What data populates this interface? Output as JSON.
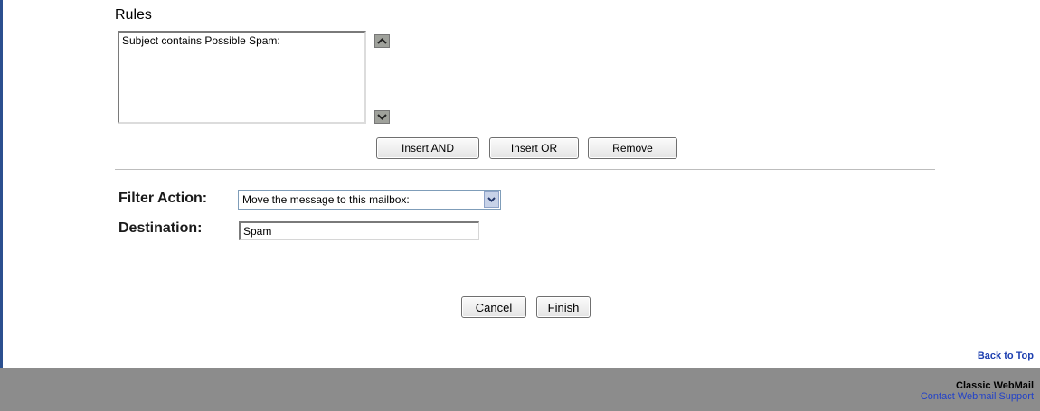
{
  "rules": {
    "heading": "Rules",
    "items": [
      "Subject contains Possible Spam:"
    ],
    "move_up_icon": "chevron-up-icon",
    "move_down_icon": "chevron-down-icon",
    "insert_and_label": "Insert AND",
    "insert_or_label": "Insert OR",
    "remove_label": "Remove"
  },
  "filter_action": {
    "label": "Filter Action:",
    "selected_value": "Move the message to this mailbox:",
    "dropdown_icon": "chevron-down-icon"
  },
  "destination": {
    "label": "Destination:",
    "value": "Spam"
  },
  "actions": {
    "cancel_label": "Cancel",
    "finish_label": "Finish"
  },
  "back_to_top_label": "Back to Top",
  "footer": {
    "title": "Classic WebMail",
    "support_link": "Contact Webmail Support"
  },
  "colors": {
    "footer_background": "#8c8c8c",
    "link_blue": "#1d3fb0",
    "left_border": "#2b4f8f"
  }
}
